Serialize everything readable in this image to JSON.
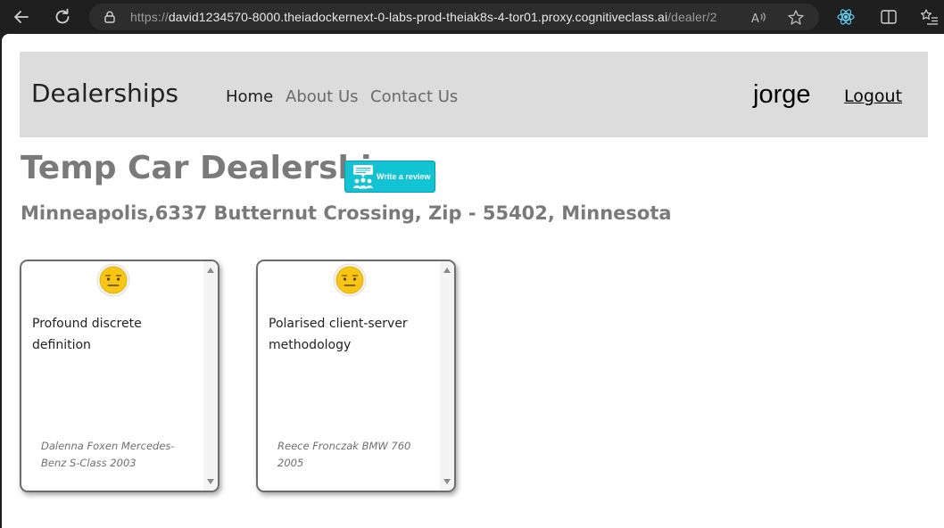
{
  "browser": {
    "url_prefix": "https://",
    "url_host": "david1234570-8000.theiadockernext-0-labs-prod-theiak8s-4-tor01.proxy.cognitiveclass.ai",
    "url_path": "/dealer/2"
  },
  "navbar": {
    "brand": "Dealerships",
    "links": [
      {
        "label": "Home",
        "active": true
      },
      {
        "label": "About Us",
        "active": false
      },
      {
        "label": "Contact Us",
        "active": false
      }
    ],
    "username": "jorge",
    "logout_label": "Logout"
  },
  "dealer": {
    "name": "Temp Car Dealership",
    "address": "Minneapolis,6337 Butternut Crossing, Zip - 55402, Minnesota",
    "review_button_label": "Write a review"
  },
  "reviews": [
    {
      "text": "Profound discrete definition",
      "reviewer": "Dalenna Foxen Mercedes-Benz S-Class 2003",
      "sentiment_icon": "neutral-face-icon"
    },
    {
      "text": "Polarised client-server methodology",
      "reviewer": "Reece Fronczak BMW 760 2005",
      "sentiment_icon": "neutral-face-icon"
    }
  ],
  "colors": {
    "navbar_bg": "#dcdcdc",
    "review_button_bg": "#11c3d3",
    "heading_gray": "#7a7a7a"
  }
}
